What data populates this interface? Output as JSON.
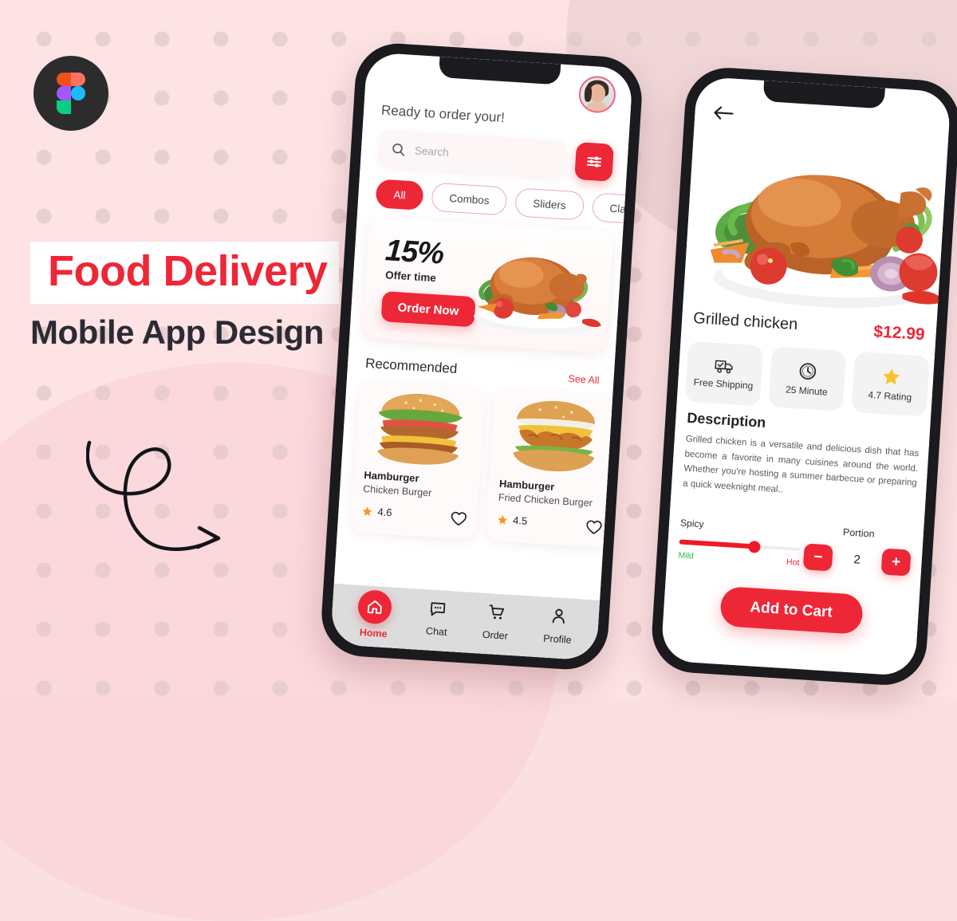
{
  "poster": {
    "logo_name": "figma-logo",
    "title": "Food Delivery",
    "subtitle": "Mobile App Design",
    "accent_red": "#ee2737",
    "background_pink": "#fde3e4",
    "arrow_name": "curly-arrow-decoration"
  },
  "home_screen": {
    "greeting": "Ready to order your!",
    "avatar_label": "user-avatar",
    "search": {
      "placeholder": "Search",
      "icon": "search-icon"
    },
    "filter_icon": "filter-sliders-icon",
    "categories": [
      {
        "label": "All",
        "active": true
      },
      {
        "label": "Combos",
        "active": false
      },
      {
        "label": "Sliders",
        "active": false
      },
      {
        "label": "Cla",
        "active": false
      }
    ],
    "promo": {
      "percent": "15%",
      "subtitle": "Offer time",
      "button": "Order Now",
      "image_name": "roast-chicken-platter"
    },
    "section": {
      "title": "Recommended",
      "link": "See All"
    },
    "cards": [
      {
        "name": "Hamburger",
        "desc": "Chicken Burger",
        "rating": "4.6",
        "image_name": "chicken-burger-photo"
      },
      {
        "name": "Hamburger",
        "desc": "Fried Chicken Burger",
        "rating": "4.5",
        "image_name": "fried-chicken-burger-photo"
      }
    ],
    "tabs": [
      {
        "label": "Home",
        "icon": "home-icon",
        "active": true
      },
      {
        "label": "Chat",
        "icon": "chat-bubble-icon",
        "active": false
      },
      {
        "label": "Order",
        "icon": "cart-icon",
        "active": false
      },
      {
        "label": "Profile",
        "icon": "person-icon",
        "active": false
      }
    ]
  },
  "detail_screen": {
    "back_icon": "back-arrow-icon",
    "hero_image_name": "roast-chicken-platter",
    "name": "Grilled chicken",
    "price": "$12.99",
    "badges": [
      {
        "label": "Free Shipping",
        "icon": "delivery-truck-icon"
      },
      {
        "label": "25 Minute",
        "icon": "clock-icon"
      },
      {
        "label": "4.7 Rating",
        "icon": "star-icon"
      }
    ],
    "description_title": "Description",
    "description_body": "Grilled chicken is a versatile and delicious dish that has become a favorite in many cuisines around the world. Whether you're hosting a summer barbecue or preparing a quick weeknight meal..",
    "spicy": {
      "label": "Spicy",
      "min_label": "Mild",
      "max_label": "Hot"
    },
    "portion": {
      "label": "Portion",
      "value": "2",
      "minus": "−",
      "plus": "+"
    },
    "cart_button": "Add to Cart"
  }
}
